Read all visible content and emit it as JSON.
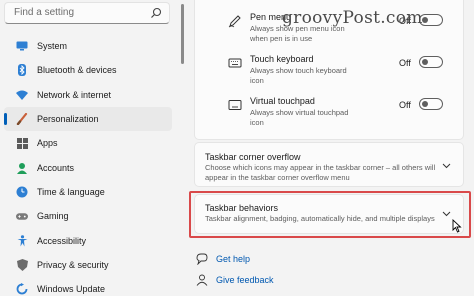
{
  "search": {
    "placeholder": "Find a setting"
  },
  "sidebar": {
    "items": [
      {
        "label": "System",
        "icon": "system-icon"
      },
      {
        "label": "Bluetooth & devices",
        "icon": "bluetooth-icon"
      },
      {
        "label": "Network & internet",
        "icon": "wifi-icon"
      },
      {
        "label": "Personalization",
        "icon": "brush-icon",
        "active": true
      },
      {
        "label": "Apps",
        "icon": "apps-icon"
      },
      {
        "label": "Accounts",
        "icon": "account-icon"
      },
      {
        "label": "Time & language",
        "icon": "globe-clock-icon"
      },
      {
        "label": "Gaming",
        "icon": "gamepad-icon"
      },
      {
        "label": "Accessibility",
        "icon": "accessibility-icon"
      },
      {
        "label": "Privacy & security",
        "icon": "shield-icon"
      },
      {
        "label": "Windows Update",
        "icon": "update-icon"
      }
    ]
  },
  "pen_rows": [
    {
      "title": "Pen menu",
      "subtitle": "Always show pen menu icon when pen is in use",
      "state": "Off",
      "icon": "pen-icon"
    },
    {
      "title": "Touch keyboard",
      "subtitle": "Always show touch keyboard icon",
      "state": "Off",
      "icon": "keyboard-icon"
    },
    {
      "title": "Virtual touchpad",
      "subtitle": "Always show virtual touchpad icon",
      "state": "Off",
      "icon": "touchpad-icon"
    }
  ],
  "corner_overflow": {
    "title": "Taskbar corner overflow",
    "subtitle": "Choose which icons may appear in the taskbar corner – all others will appear in the taskbar corner overflow menu"
  },
  "behaviors": {
    "title": "Taskbar behaviors",
    "subtitle": "Taskbar alignment, badging, automatically hide, and multiple displays"
  },
  "links": {
    "help": "Get help",
    "feedback": "Give feedback"
  },
  "watermark": "groovyPost.com",
  "colors": {
    "accent": "#005fb8",
    "highlight": "#d9494a",
    "link": "#0058b0"
  }
}
